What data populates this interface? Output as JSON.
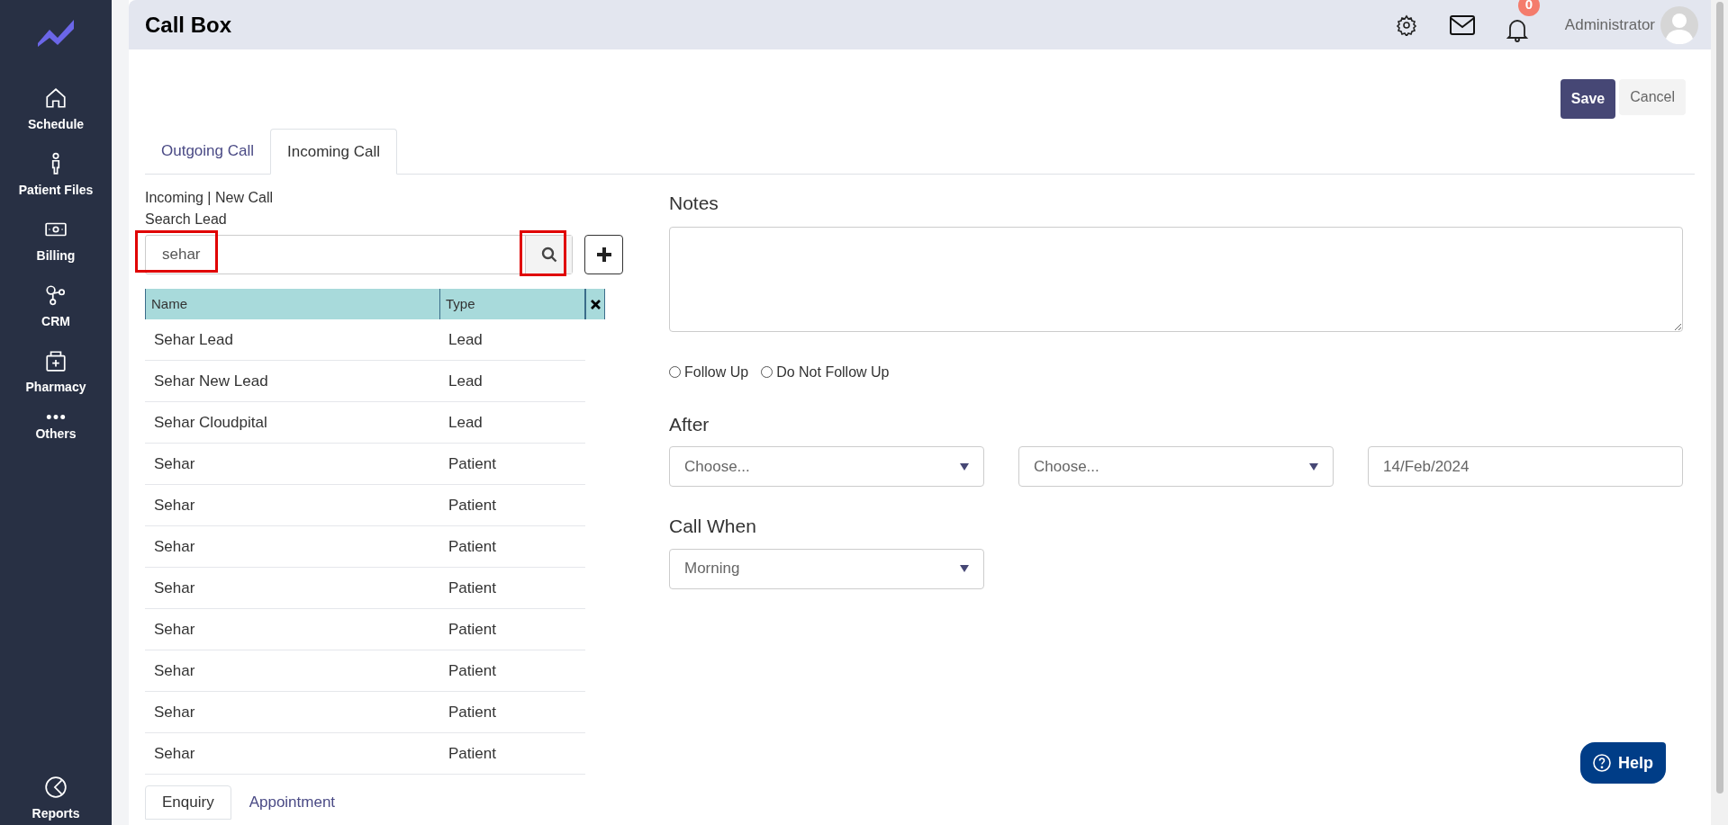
{
  "sidebar": {
    "items": [
      {
        "label": "Schedule"
      },
      {
        "label": "Patient Files"
      },
      {
        "label": "Billing"
      },
      {
        "label": "CRM"
      },
      {
        "label": "Pharmacy"
      },
      {
        "label": "Others"
      }
    ],
    "bottom_item": {
      "label": "Reports"
    }
  },
  "header": {
    "title": "Call Box",
    "notification_count": "0",
    "user": "Administrator"
  },
  "actions": [
    "Save",
    "Cancel"
  ],
  "tabs": [
    {
      "label": "Outgoing Call",
      "selected": false
    },
    {
      "label": "Incoming Call",
      "selected": true
    }
  ],
  "breadcrumb": "Incoming | New Call",
  "search": {
    "label": "Search Lead",
    "value": "sehar",
    "highlighted": true,
    "button_highlighted": true
  },
  "results": {
    "columns": [
      "Name",
      "Type"
    ],
    "rows": [
      [
        "Sehar Lead",
        "Lead"
      ],
      [
        "Sehar New Lead",
        "Lead"
      ],
      [
        "Sehar Cloudpital",
        "Lead"
      ],
      [
        "Sehar",
        "Patient"
      ],
      [
        "Sehar",
        "Patient"
      ],
      [
        "Sehar",
        "Patient"
      ],
      [
        "Sehar",
        "Patient"
      ],
      [
        "Sehar",
        "Patient"
      ],
      [
        "Sehar",
        "Patient"
      ],
      [
        "Sehar",
        "Patient"
      ],
      [
        "Sehar",
        "Patient"
      ]
    ]
  },
  "bottom_tabs": [
    {
      "label": "Enquiry",
      "selected": true
    },
    {
      "label": "Appointment",
      "selected": false
    }
  ],
  "notes": {
    "label": "Notes"
  },
  "follow_up": [
    {
      "label": "Follow Up",
      "selected": false
    },
    {
      "label": "Do Not Follow Up",
      "selected": false
    }
  ],
  "after": {
    "label": "After",
    "selects": [
      "Choose...",
      "Choose..."
    ],
    "date": "14/Feb/2024"
  },
  "call_when": {
    "label": "Call When",
    "value": "Morning"
  },
  "help_button": "Help"
}
